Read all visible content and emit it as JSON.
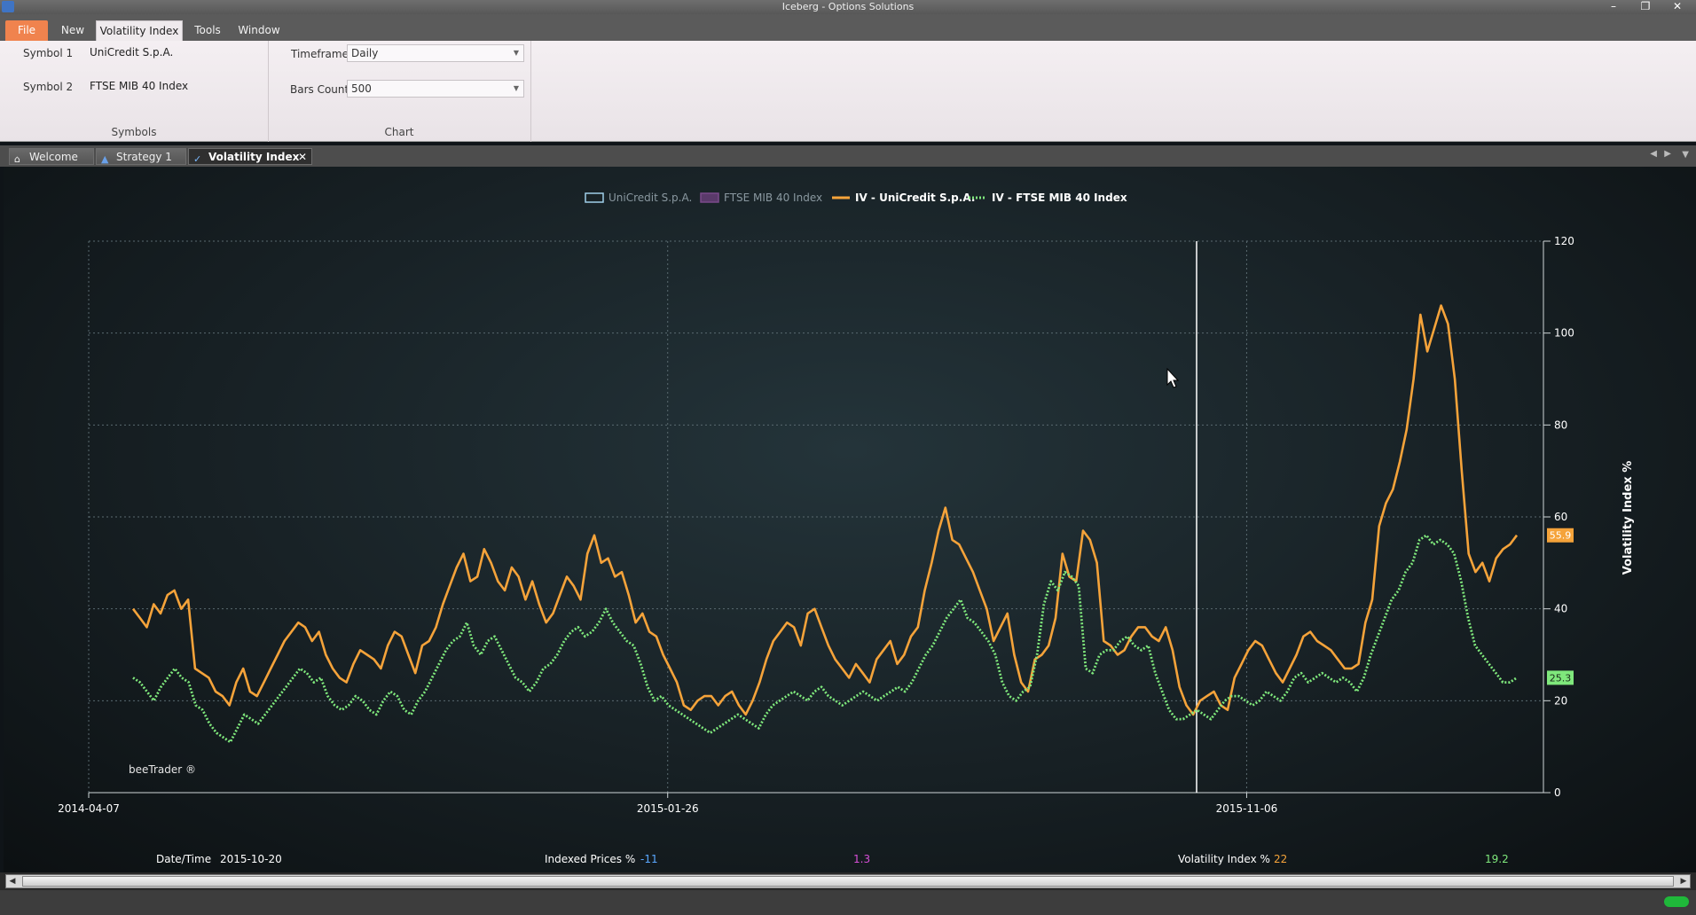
{
  "window": {
    "title": "Iceberg - Options Solutions"
  },
  "menu": {
    "file": "File",
    "new": "New",
    "volatility": "Volatility Index",
    "tools": "Tools",
    "window": "Window"
  },
  "ribbon": {
    "symbol1_label": "Symbol 1",
    "symbol1_value": "UniCredit S.p.A.",
    "symbol2_label": "Symbol 2",
    "symbol2_value": "FTSE MIB 40 Index",
    "symbols_group": "Symbols",
    "timeframe_label": "Timeframe",
    "timeframe_value": "Daily",
    "bars_label": "Bars Count",
    "bars_value": "500",
    "chart_group": "Chart"
  },
  "tabs": [
    {
      "label": "Welcome"
    },
    {
      "label": "Strategy 1"
    },
    {
      "label": "Volatility Index"
    }
  ],
  "chart_data": {
    "type": "line",
    "legend": [
      "UniCredit S.p.A.",
      "FTSE MIB 40 Index",
      "IV - UniCredit S.p.A.",
      "IV - FTSE MIB 40 Index"
    ],
    "ylabel": "Volatility Index %",
    "ylim": [
      0,
      120
    ],
    "yticks": [
      "0",
      "20",
      "40",
      "60",
      "80",
      "100",
      "120"
    ],
    "xticks": [
      "2014-04-07",
      "2015-01-26",
      "2015-11-06"
    ],
    "watermark": "beeTrader ®",
    "last_values": {
      "iv_unicredit": "55.9",
      "iv_ftse": "25.3"
    },
    "series": [
      {
        "name": "IV - UniCredit S.p.A.",
        "color": "#f5a33a",
        "values": [
          40,
          38,
          36,
          41,
          39,
          43,
          44,
          40,
          42,
          27,
          26,
          25,
          22,
          21,
          19,
          24,
          27,
          22,
          21,
          24,
          27,
          30,
          33,
          35,
          37,
          36,
          33,
          35,
          30,
          27,
          25,
          24,
          28,
          31,
          30,
          29,
          27,
          32,
          35,
          34,
          30,
          26,
          32,
          33,
          36,
          41,
          45,
          49,
          52,
          46,
          47,
          53,
          50,
          46,
          44,
          49,
          47,
          42,
          46,
          41,
          37,
          39,
          43,
          47,
          45,
          42,
          52,
          56,
          50,
          51,
          47,
          48,
          43,
          37,
          39,
          35,
          34,
          30,
          27,
          24,
          19,
          18,
          20,
          21,
          21,
          19,
          21,
          22,
          19,
          17,
          20,
          24,
          29,
          33,
          35,
          37,
          36,
          32,
          39,
          40,
          36,
          32,
          29,
          27,
          25,
          28,
          26,
          24,
          29,
          31,
          33,
          28,
          30,
          34,
          36,
          44,
          50,
          57,
          62,
          55,
          54,
          51,
          48,
          44,
          40,
          33,
          36,
          39,
          30,
          24,
          22,
          29,
          30,
          32,
          38,
          52,
          47,
          46,
          57,
          55,
          50,
          33,
          32,
          30,
          31,
          34,
          36,
          36,
          34,
          33,
          36,
          31,
          23,
          19,
          17,
          20,
          21,
          22,
          19,
          18,
          25,
          28,
          31,
          33,
          32,
          29,
          26,
          24,
          27,
          30,
          34,
          35,
          33,
          32,
          31,
          29,
          27,
          27,
          28,
          37,
          42,
          58,
          63,
          66,
          72,
          79,
          90,
          104,
          96,
          101,
          106,
          102,
          90,
          70,
          52,
          48,
          50,
          46,
          51,
          53,
          54,
          56
        ]
      },
      {
        "name": "IV - FTSE MIB 40 Index",
        "color": "#7fe87c",
        "values": [
          25,
          24,
          22,
          20,
          23,
          25,
          27,
          25,
          24,
          19,
          18,
          15,
          13,
          12,
          11,
          14,
          17,
          16,
          15,
          17,
          19,
          21,
          23,
          25,
          27,
          26,
          24,
          25,
          21,
          19,
          18,
          19,
          21,
          20,
          18,
          17,
          20,
          22,
          21,
          18,
          17,
          20,
          22,
          25,
          28,
          31,
          33,
          34,
          37,
          32,
          30,
          33,
          34,
          31,
          28,
          25,
          24,
          22,
          24,
          27,
          28,
          30,
          33,
          35,
          36,
          34,
          35,
          37,
          40,
          37,
          35,
          33,
          32,
          28,
          23,
          20,
          21,
          19,
          18,
          17,
          16,
          15,
          14,
          13,
          14,
          15,
          16,
          17,
          16,
          15,
          14,
          17,
          19,
          20,
          21,
          22,
          21,
          20,
          22,
          23,
          21,
          20,
          19,
          20,
          21,
          22,
          21,
          20,
          21,
          22,
          23,
          22,
          24,
          27,
          30,
          32,
          35,
          38,
          40,
          42,
          38,
          37,
          35,
          33,
          30,
          24,
          21,
          20,
          22,
          23,
          30,
          41,
          46,
          44,
          48,
          47,
          45,
          27,
          26,
          30,
          31,
          31,
          33,
          34,
          32,
          31,
          32,
          26,
          22,
          18,
          16,
          16,
          17,
          18,
          17,
          16,
          18,
          20,
          21,
          21,
          20,
          19,
          20,
          22,
          21,
          20,
          22,
          25,
          26,
          24,
          25,
          26,
          25,
          24,
          25,
          24,
          22,
          25,
          30,
          34,
          38,
          42,
          44,
          48,
          50,
          55,
          56,
          54,
          55,
          54,
          52,
          46,
          38,
          32,
          30,
          28,
          26,
          24,
          24,
          25
        ]
      }
    ]
  },
  "status": {
    "datetime_label": "Date/Time",
    "datetime_value": "2015-10-20",
    "indexed_label": "Indexed Prices %",
    "indexed_val1": "-11",
    "indexed_val2": "1.3",
    "vol_label": "Volatility Index %",
    "vol_val1": "22",
    "vol_val2": "19.2"
  },
  "colors": {
    "accent_file": "#f0834e",
    "iv_unicredit": "#f5a33a",
    "iv_ftse": "#7fe87c"
  }
}
